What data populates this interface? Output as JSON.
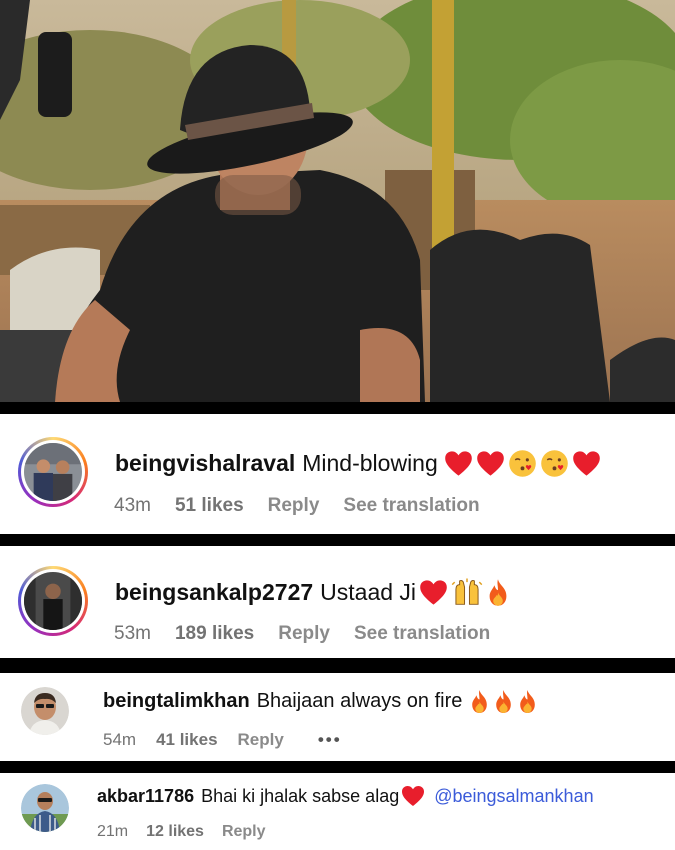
{
  "photo": {
    "alt": "man in black hat and t-shirt seated in open safari vehicle"
  },
  "comments": [
    {
      "username": "beingvishalraval",
      "text": "Mind-blowing",
      "emojis": [
        "red-heart",
        "red-heart",
        "face-blowing-kiss",
        "face-blowing-kiss",
        "red-heart"
      ],
      "time": "43m",
      "likes": "51 likes",
      "reply": "Reply",
      "translate": "See translation"
    },
    {
      "username": "beingsankalp2727",
      "text": "Ustaad Ji",
      "emojis": [
        "red-heart",
        "raising-hands",
        "fire"
      ],
      "time": "53m",
      "likes": "189 likes",
      "reply": "Reply",
      "translate": "See translation"
    },
    {
      "username": "beingtalimkhan",
      "text": "Bhaijaan always on fire",
      "emojis": [
        "fire",
        "fire",
        "fire"
      ],
      "time": "54m",
      "likes": "41 likes",
      "reply": "Reply",
      "more": "•••"
    },
    {
      "username": "akbar11786",
      "text": "Bhai ki jhalak sabse alag",
      "emojis": [
        "red-heart"
      ],
      "mention": "@beingsalmankhan",
      "time": "21m",
      "likes": "12 likes",
      "reply": "Reply"
    }
  ]
}
